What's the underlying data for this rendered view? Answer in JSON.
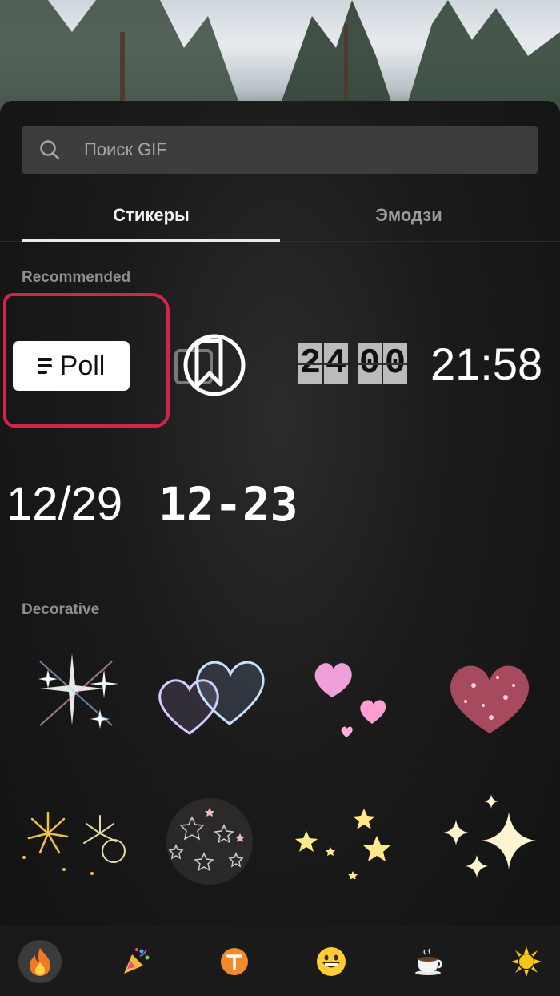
{
  "search": {
    "placeholder": "Поиск GIF"
  },
  "tabs": [
    {
      "label": "Стикеры",
      "active": true
    },
    {
      "label": "Эмодзи",
      "active": false
    }
  ],
  "sections": {
    "recommended": "Recommended",
    "decorative": "Decorative"
  },
  "recommended_stickers": {
    "poll": "Poll",
    "flip_clock": [
      "2",
      "4",
      "0",
      "0"
    ],
    "digital_time": "21:58",
    "date_slash": "12/29",
    "date_dash": "12-23"
  },
  "decorative_stickers": [
    "sparkle-cross-sticker",
    "bubble-hearts-sticker",
    "pink-hearts-sticker",
    "glitter-heart-sticker",
    "fireworks-sticker",
    "star-ball-sticker",
    "yellow-stars-sticker",
    "twinkle-stars-sticker"
  ],
  "categories": [
    {
      "icon": "fire-icon",
      "active": true
    },
    {
      "icon": "party-popper-icon",
      "active": false
    },
    {
      "icon": "text-t-icon",
      "active": false
    },
    {
      "icon": "smiley-icon",
      "active": false
    },
    {
      "icon": "coffee-icon",
      "active": false
    },
    {
      "icon": "sun-icon",
      "active": false
    }
  ],
  "colors": {
    "highlight": "#d4244a",
    "accent_orange": "#f08a2b"
  }
}
